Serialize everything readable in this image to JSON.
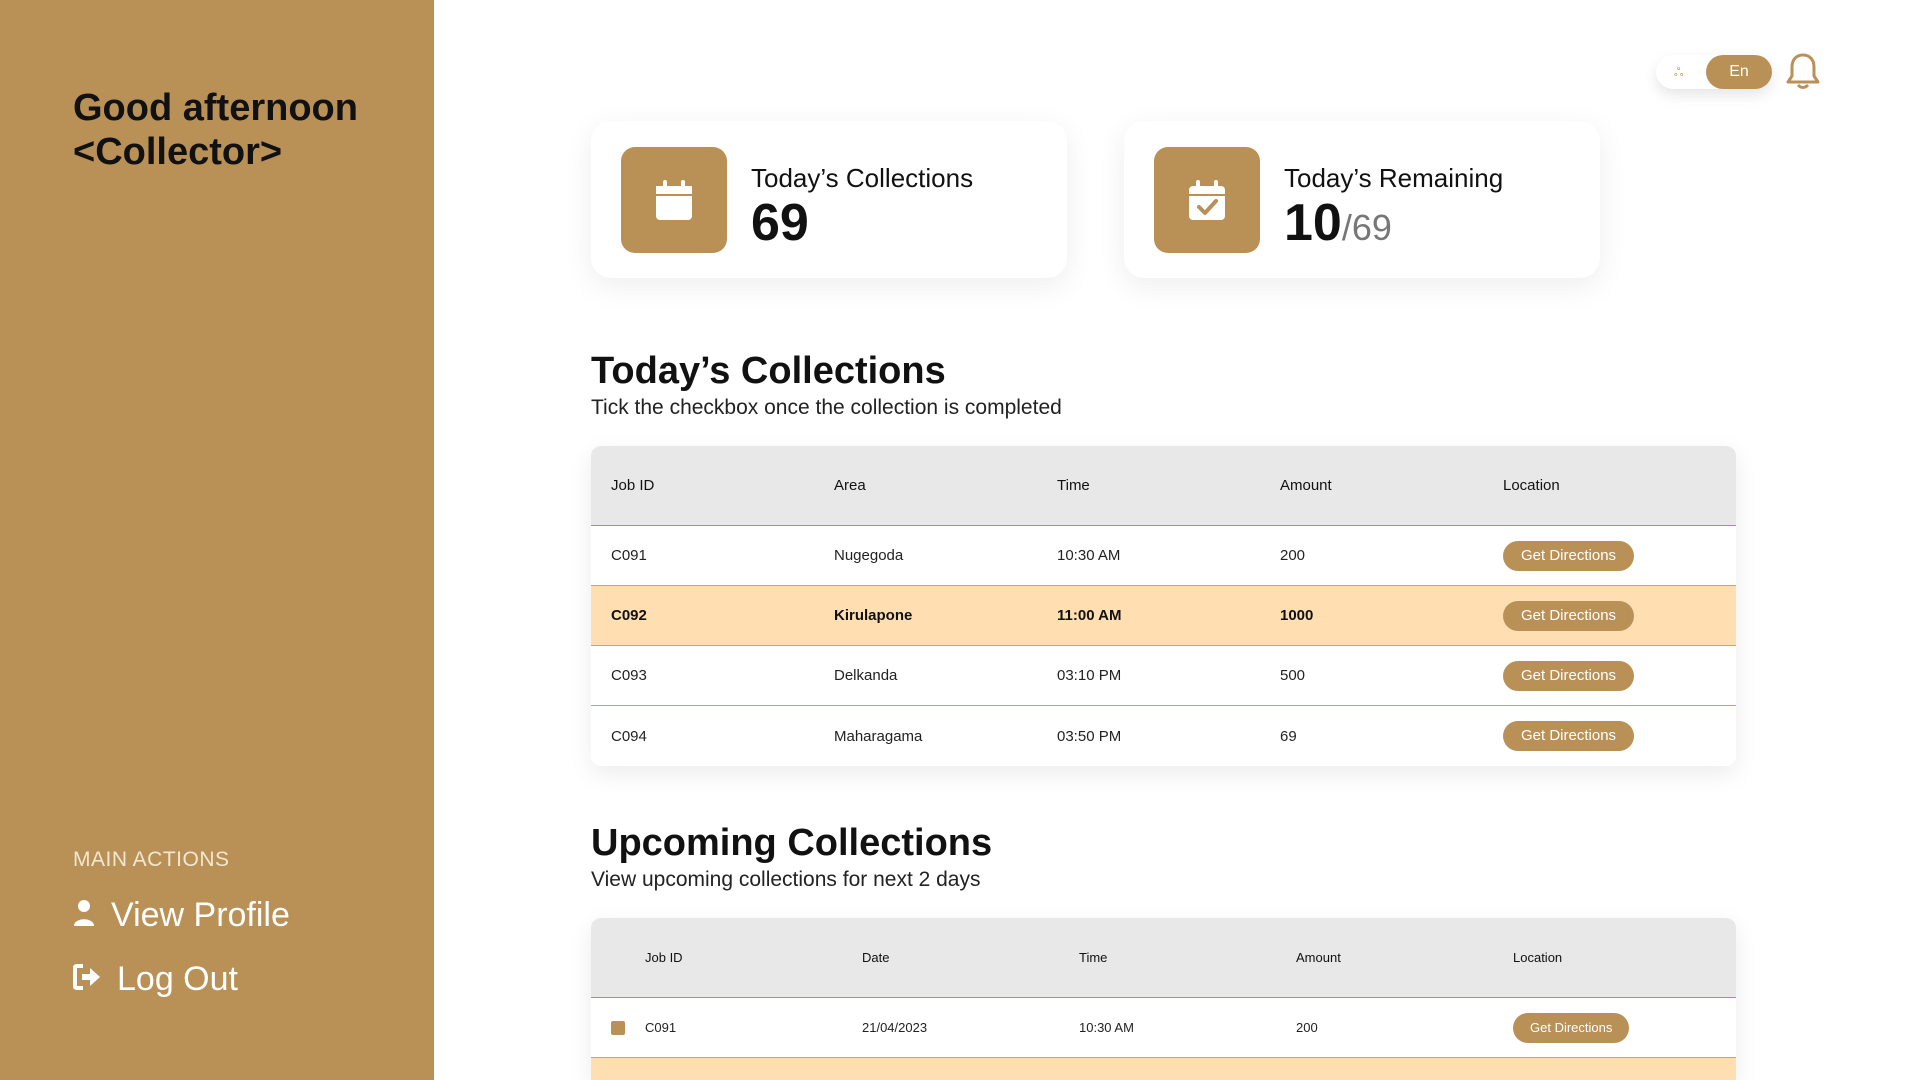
{
  "sidebar": {
    "greeting_line1": "Good afternoon",
    "greeting_line2": "<Collector>",
    "actions_heading": "MAIN ACTIONS",
    "actions": [
      {
        "label": "View Profile",
        "icon": "user-icon"
      },
      {
        "label": "Log Out",
        "icon": "logout-icon"
      }
    ]
  },
  "header": {
    "language_alt": "ஃ",
    "language_active": "En",
    "notification_icon": "bell-icon"
  },
  "stats": [
    {
      "title": "Today’s Collections",
      "value": "69",
      "icon": "calendar-icon"
    },
    {
      "title": "Today’s Remaining",
      "value": "10",
      "total": "/69",
      "icon": "calendar-check-icon"
    }
  ],
  "today": {
    "title": "Today’s Collections",
    "subtitle": "Tick the checkbox once the collection is completed",
    "columns": [
      "Job ID",
      "Area",
      "Time",
      "Amount",
      "Location"
    ],
    "rows": [
      {
        "job_id": "C091",
        "area": "Nugegoda",
        "time": "10:30 AM",
        "amount": "200",
        "action": "Get Directions",
        "highlighted": false
      },
      {
        "job_id": "C092",
        "area": "Kirulapone",
        "time": "11:00 AM",
        "amount": "1000",
        "action": "Get Directions",
        "highlighted": true
      },
      {
        "job_id": "C093",
        "area": "Delkanda",
        "time": "03:10 PM",
        "amount": "500",
        "action": "Get Directions",
        "highlighted": false
      },
      {
        "job_id": "C094",
        "area": "Maharagama",
        "time": "03:50 PM",
        "amount": "69",
        "action": "Get Directions",
        "highlighted": false
      }
    ]
  },
  "upcoming": {
    "title": "Upcoming Collections",
    "subtitle": "View upcoming collections for next 2 days",
    "columns": [
      "Job ID",
      "Date",
      "Time",
      "Amount",
      "Location"
    ],
    "rows": [
      {
        "job_id": "C091",
        "date": "21/04/2023",
        "time": "10:30 AM",
        "amount": "200",
        "action": "Get Directions",
        "highlighted": false
      },
      {
        "job_id": "",
        "date": "",
        "time": "",
        "amount": "",
        "action": "",
        "highlighted": true
      }
    ]
  },
  "colors": {
    "accent": "#b99156",
    "highlight_row": "#ffdfb2",
    "header_row": "#e8e8e8"
  }
}
